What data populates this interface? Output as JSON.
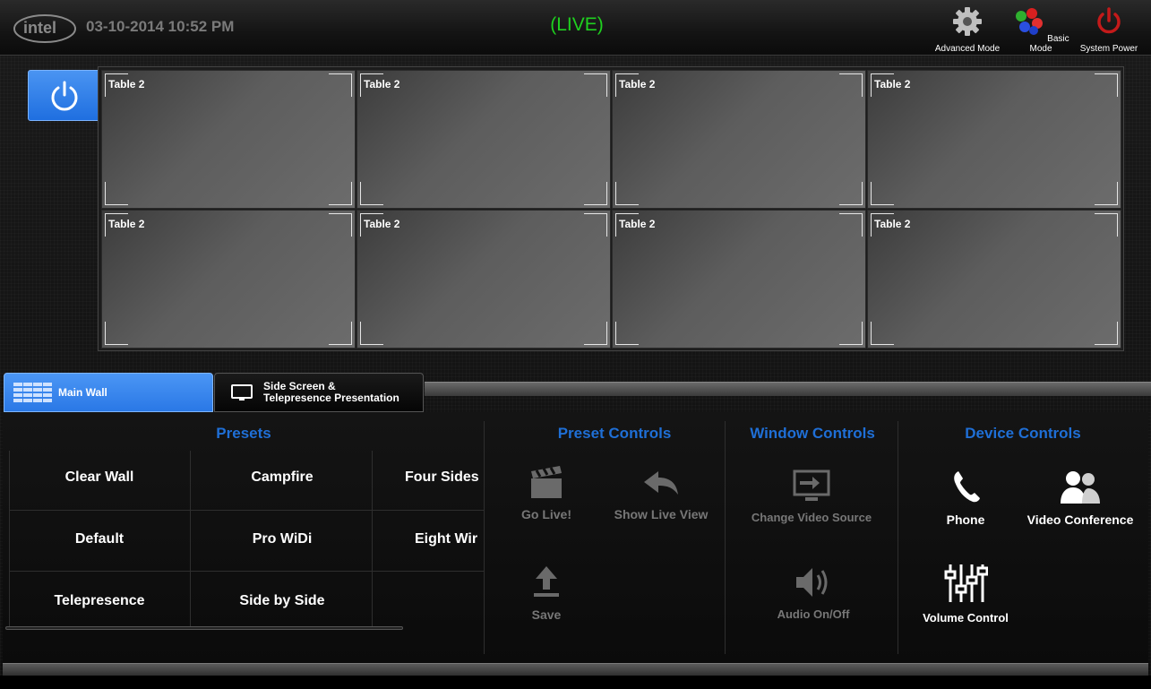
{
  "header": {
    "logo_text": "intel",
    "datetime": "03-10-2014 10:52 PM",
    "status": "(LIVE)",
    "buttons": [
      {
        "label": "Advanced Mode",
        "icon": "gear-icon"
      },
      {
        "label": "Basic Mode",
        "icon": "color-balls-icon"
      },
      {
        "label": "System Power",
        "icon": "power-icon"
      }
    ]
  },
  "wall": {
    "power_icon": "power-icon",
    "cells": [
      "Table 2",
      "Table 2",
      "Table 2",
      "Table 2",
      "Table 2",
      "Table 2",
      "Table 2",
      "Table 2"
    ]
  },
  "tabs": {
    "main": "Main Wall",
    "side_line1": "Side Screen &",
    "side_line2": "Telepresence Presentation"
  },
  "presets": {
    "title": "Presets",
    "items": [
      "Clear Wall",
      "Campfire",
      "Four Sides",
      "Default",
      "Pro WiDi",
      "Eight Wir",
      "Telepresence",
      "Side by Side"
    ]
  },
  "preset_controls": {
    "title": "Preset Controls",
    "go_live": "Go Live!",
    "show_live_view": "Show Live View",
    "save": "Save"
  },
  "window_controls": {
    "title": "Window Controls",
    "change_video_source": "Change Video Source",
    "audio": "Audio On/Off"
  },
  "device_controls": {
    "title": "Device Controls",
    "phone": "Phone",
    "video_conference": "Video Conference",
    "volume_control": "Volume Control"
  }
}
